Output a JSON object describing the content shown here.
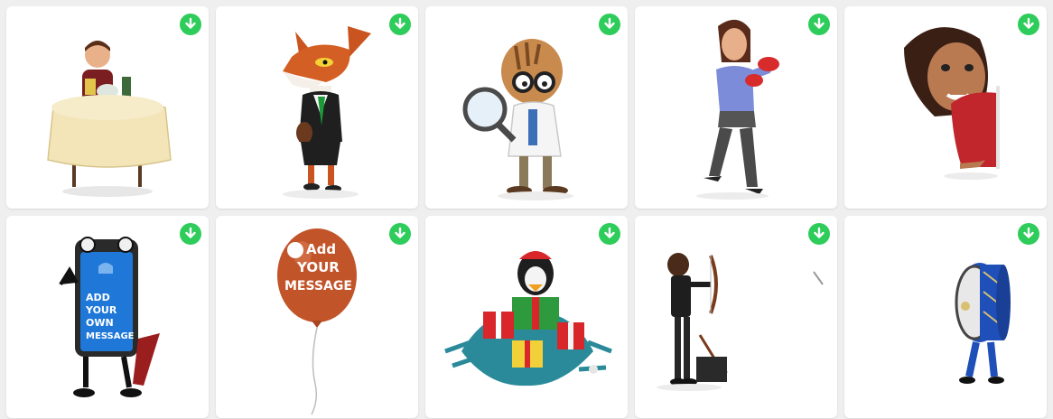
{
  "colors": {
    "page_background": "#efefef",
    "card_background": "#ffffff",
    "download_button": "#2ecc5a"
  },
  "download_icon": "download-arrow-icon",
  "cards": [
    {
      "subject": "character-at-table"
    },
    {
      "subject": "fox-in-business-suit"
    },
    {
      "subject": "detective-with-magnifying-glass"
    },
    {
      "subject": "woman-boxing"
    },
    {
      "subject": "woman-peeking-pointing"
    },
    {
      "subject": "phone-character-message",
      "text_lines": [
        "ADD",
        "YOUR",
        "OWN",
        "MESSAGE"
      ]
    },
    {
      "subject": "balloon-message",
      "text_lines": [
        "Add",
        "YOUR",
        "MESSAGE"
      ]
    },
    {
      "subject": "christmas-penguin-presents"
    },
    {
      "subject": "archer-with-bow"
    },
    {
      "subject": "drum-character"
    }
  ]
}
